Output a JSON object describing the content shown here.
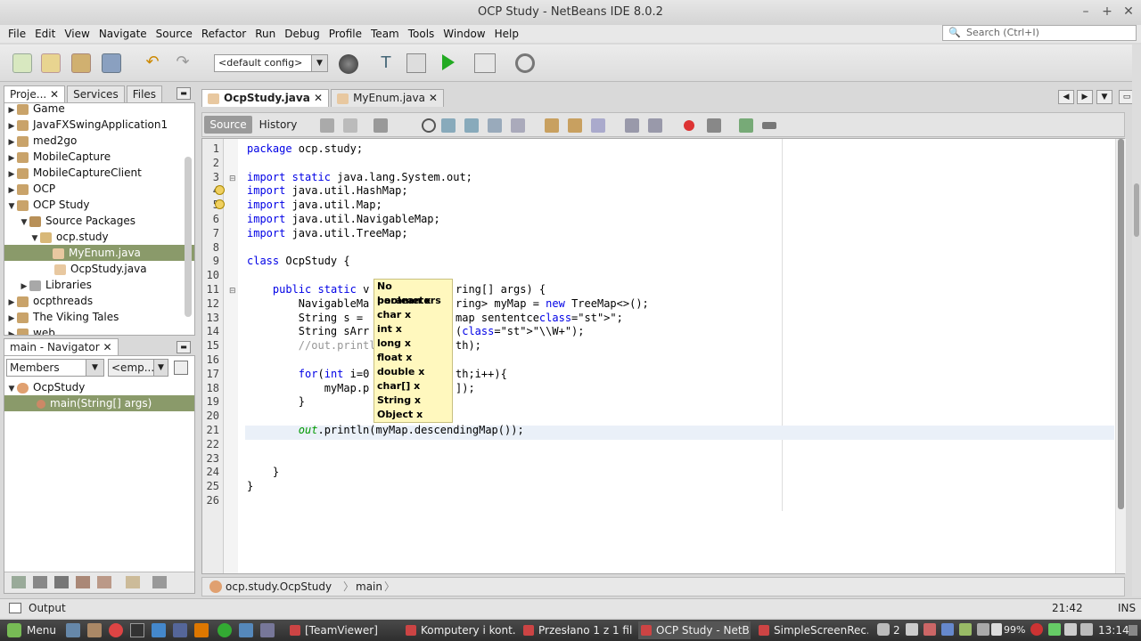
{
  "window": {
    "title": "OCP Study - NetBeans IDE 8.0.2"
  },
  "menu": [
    "File",
    "Edit",
    "View",
    "Navigate",
    "Source",
    "Refactor",
    "Run",
    "Debug",
    "Profile",
    "Team",
    "Tools",
    "Window",
    "Help"
  ],
  "search": {
    "placeholder": "Search (Ctrl+I)"
  },
  "toolbar": {
    "config": "<default config>"
  },
  "projects_tabs": [
    "Proje...",
    "Services",
    "Files"
  ],
  "tree": [
    {
      "label": "Game",
      "depth": 0,
      "arrow": "▶"
    },
    {
      "label": "JavaFXSwingApplication1",
      "depth": 0,
      "arrow": "▶"
    },
    {
      "label": "med2go",
      "depth": 0,
      "arrow": "▶"
    },
    {
      "label": "MobileCapture",
      "depth": 0,
      "arrow": "▶"
    },
    {
      "label": "MobileCaptureClient",
      "depth": 0,
      "arrow": "▶"
    },
    {
      "label": "OCP",
      "depth": 0,
      "arrow": "▶"
    },
    {
      "label": "OCP Study",
      "depth": 0,
      "arrow": "▼"
    },
    {
      "label": "Source Packages",
      "depth": 1,
      "arrow": "▼"
    },
    {
      "label": "ocp.study",
      "depth": 2,
      "arrow": "▼"
    },
    {
      "label": "MyEnum.java",
      "depth": 3,
      "arrow": ""
    },
    {
      "label": "OcpStudy.java",
      "depth": 3,
      "arrow": ""
    },
    {
      "label": "Libraries",
      "depth": 1,
      "arrow": "▶"
    },
    {
      "label": "ocpthreads",
      "depth": 0,
      "arrow": "▶"
    },
    {
      "label": "The Viking Tales",
      "depth": 0,
      "arrow": "▶"
    },
    {
      "label": "web",
      "depth": 0,
      "arrow": "▶"
    }
  ],
  "navigator": {
    "title": "main - Navigator",
    "members": "Members",
    "filter": "<emp...",
    "items": [
      {
        "label": "OcpStudy"
      },
      {
        "label": "main(String[] args)"
      }
    ]
  },
  "editor_tabs": [
    "OcpStudy.java",
    "MyEnum.java"
  ],
  "editor_toolbar": {
    "source": "Source",
    "history": "History"
  },
  "code_lines": [
    "package ocp.study;",
    "",
    "import static java.lang.System.out;",
    "import java.util.HashMap;",
    "import java.util.Map;",
    "import java.util.NavigableMap;",
    "import java.util.TreeMap;",
    "",
    "class OcpStudy {",
    "",
    "    public static v",
    "        NavigableMa",
    "        String s =",
    "        String sArr",
    "        //out.printl",
    "",
    "        for(int i=0",
    "            myMap.p",
    "        }",
    "",
    "        out.println(myMap.descendingMap());",
    "",
    "",
    "    }",
    "}",
    ""
  ],
  "code_tails": [
    {
      "line": 11,
      "text": "ring[] args) {"
    },
    {
      "line": 12,
      "text": "ring> myMap = new TreeMap<>();"
    },
    {
      "line": 13,
      "text": "map sententce\";"
    },
    {
      "line": 14,
      "text": "(\"\\\\W+\");"
    },
    {
      "line": 15,
      "text": "th);"
    },
    {
      "line": 17,
      "text": "th;i++){"
    },
    {
      "line": 18,
      "text": "]);"
    }
  ],
  "popup": [
    "No parameters",
    "boolean x",
    "char x",
    "int x",
    "long x",
    "float x",
    "double x",
    "char[] x",
    "String x",
    "Object x"
  ],
  "breadcrumb": [
    "ocp.study.OcpStudy",
    "main"
  ],
  "status": {
    "output": "Output",
    "position": "21:42",
    "mode": "INS"
  },
  "taskbar": {
    "menu": "Menu",
    "tasks": [
      "[TeamViewer]",
      "Komputery i kont...",
      "Przesłano 1 z 1 fil...",
      "OCP Study - NetB...",
      "SimpleScreenRec..."
    ],
    "battery": "99%",
    "workspaces": "2",
    "clock": "13:14"
  }
}
